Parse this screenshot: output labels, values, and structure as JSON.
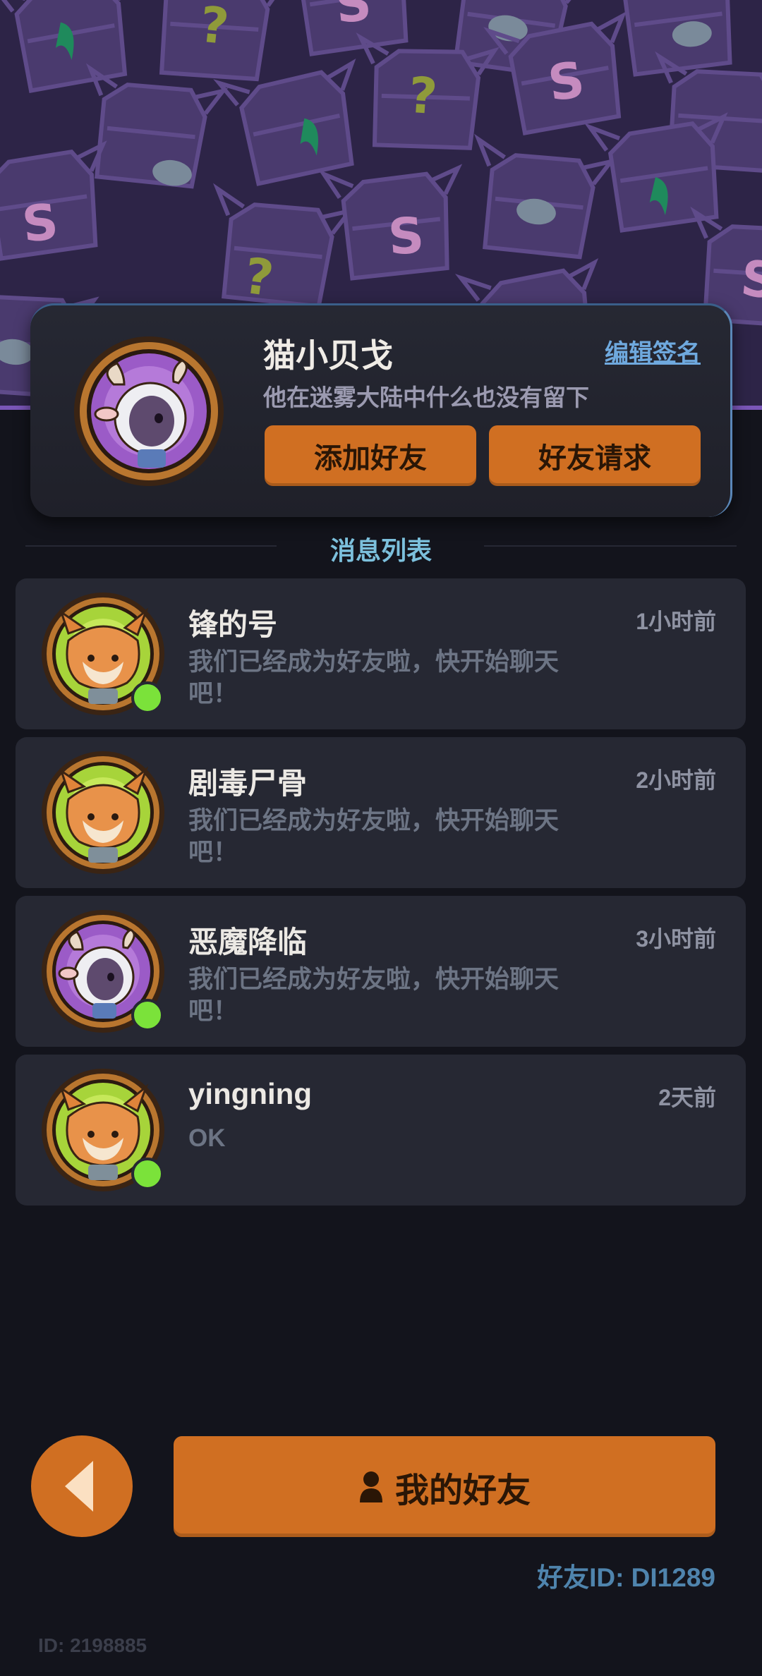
{
  "profile": {
    "name": "猫小贝戈",
    "edit_sign_label": "编辑签名",
    "signature": "他在迷雾大陆中什么也没有留下",
    "add_friend_label": "添加好友",
    "friend_requests_label": "好友请求"
  },
  "messages_section": {
    "title": "消息列表"
  },
  "messages": [
    {
      "name": "锋的号",
      "time": "1小时前",
      "text": "我们已经成为好友啦，快开始聊天吧！",
      "avatar": "fox-avatar",
      "online": true
    },
    {
      "name": "剧毒尸骨",
      "time": "2小时前",
      "text": "我们已经成为好友啦，快开始聊天吧！",
      "avatar": "fox-avatar",
      "online": false
    },
    {
      "name": "恶魔降临",
      "time": "3小时前",
      "text": "我们已经成为好友啦，快开始聊天吧！",
      "avatar": "sheep-avatar",
      "online": true
    },
    {
      "name": "yingning",
      "time": "2天前",
      "text": "OK",
      "avatar": "fox-avatar",
      "online": true
    }
  ],
  "bottom": {
    "my_friends_label": "我的好友",
    "friend_id": "好友ID: DI1289",
    "user_id": "ID: 2198885"
  },
  "colors": {
    "accent_orange": "#d06f22",
    "online_green": "#7be23a",
    "link_blue": "#6fa9de",
    "section_cyan": "#7cc0dc",
    "banner_purple": "#2d2447"
  }
}
